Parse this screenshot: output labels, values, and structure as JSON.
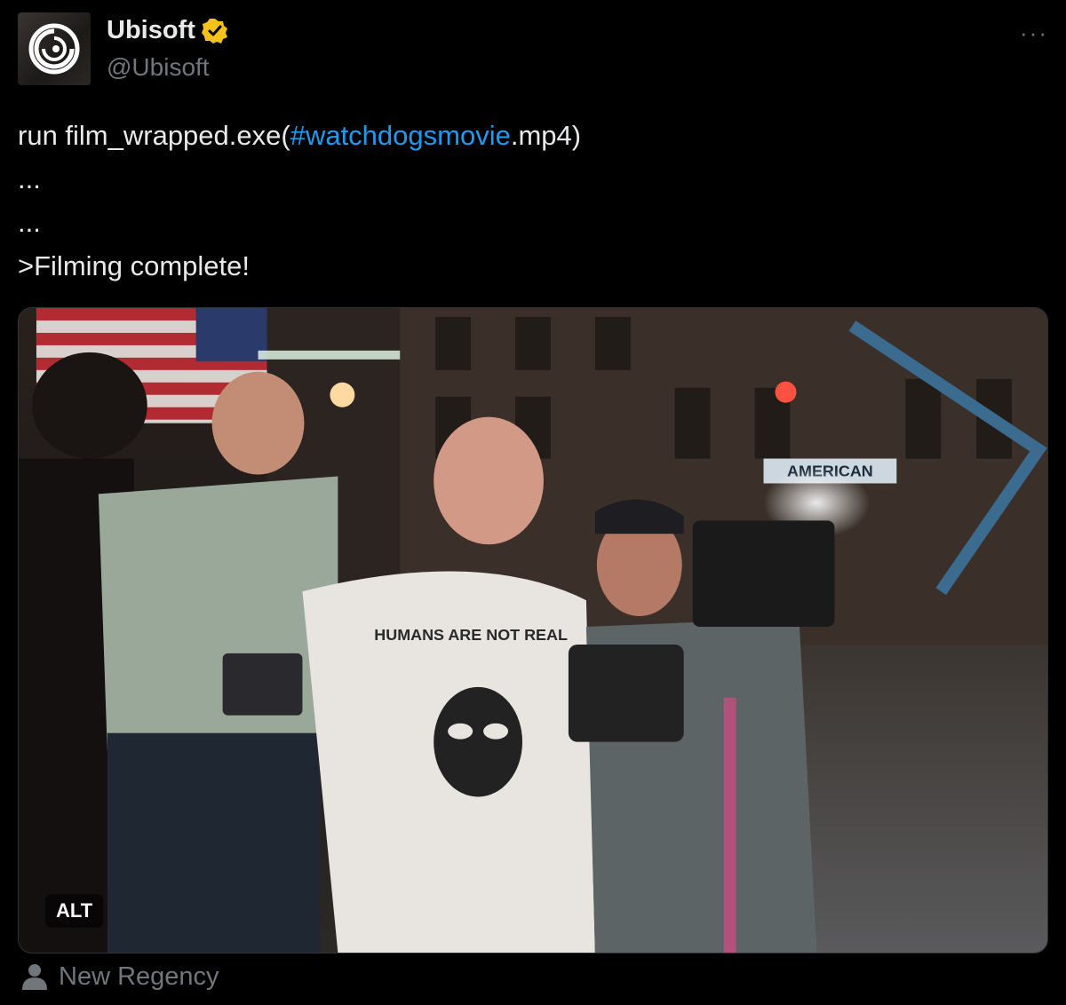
{
  "author": {
    "display_name": "Ubisoft",
    "handle": "@Ubisoft",
    "verified_badge_color": "#f4c21b",
    "avatar_icon": "ubisoft-swirl-logo"
  },
  "menu": {
    "more_label": "···"
  },
  "tweet": {
    "line1_prefix": "run film_wrapped.exe(",
    "hashtag": "#watchdogsmovie",
    "line1_suffix": ".mp4)",
    "line2": "...",
    "line3": "...",
    "line4": ">Filming complete!"
  },
  "media": {
    "alt_label": "ALT",
    "tshirt_text": "HUMANS ARE NOT REAL",
    "sign_text": "AMERICAN"
  },
  "credit": {
    "icon": "person-icon",
    "text": "New Regency"
  },
  "colors": {
    "background": "#000000",
    "text": "#e7e9ea",
    "muted": "#71767b",
    "link": "#1d9bf0"
  }
}
